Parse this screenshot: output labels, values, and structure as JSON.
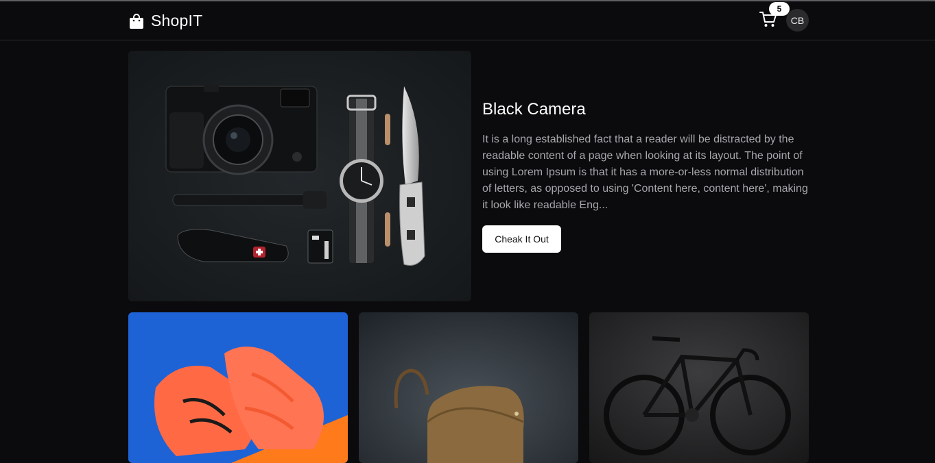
{
  "navbar": {
    "brand_name": "ShopIT",
    "brand_icon": "shopping-bag-icon",
    "cart_icon": "cart-icon",
    "cart_count": "5",
    "user_initials": "CB"
  },
  "hero": {
    "title": "Black Camera",
    "description": "It is a long established fact that a reader will be distracted by the readable content of a page when looking at its layout. The point of using Lorem Ipsum is that it has a more-or-less normal distribution of letters, as opposed to using 'Content here, content here', making it look like readable Eng...",
    "button_label": "Cheak It Out"
  },
  "products": [
    {
      "image": "orange-sneakers"
    },
    {
      "image": "brown-leather-bag"
    },
    {
      "image": "black-road-bike"
    }
  ],
  "colors": {
    "background": "#0b0a0c",
    "accent": "#ffffff",
    "muted_text": "#a7a7ac"
  }
}
